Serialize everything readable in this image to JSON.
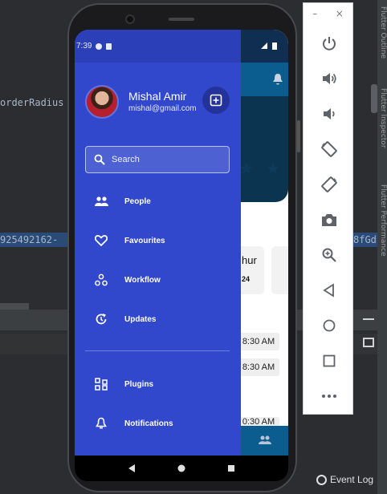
{
  "ide": {
    "code_left": "orderRadius",
    "highlight_left": "925492162-",
    "highlight_right": "8fGd",
    "side_labels": [
      "Flutter Outline",
      "Flutter Inspector",
      "Flutter Performance"
    ],
    "event_log": "Event Log"
  },
  "phone": {
    "status_time": "7:39",
    "drawer": {
      "user": {
        "name": "Mishal Amir",
        "email": "mishal@gmail.com"
      },
      "search": {
        "placeholder": "Search"
      },
      "items": [
        {
          "label": "People",
          "icon": "people-icon"
        },
        {
          "label": "Favourites",
          "icon": "heart-icon"
        },
        {
          "label": "Workflow",
          "icon": "workflow-icon"
        },
        {
          "label": "Updates",
          "icon": "updates-icon"
        }
      ],
      "secondary_items": [
        {
          "label": "Plugins",
          "icon": "plugins-icon"
        },
        {
          "label": "Notifications",
          "icon": "bell-icon"
        }
      ]
    },
    "background_app": {
      "card_text_1": "hur",
      "card_text_2": "24",
      "times": [
        "8:30 AM",
        "8:30 AM",
        "0:30 AM"
      ]
    }
  },
  "emulator": {
    "minimize_label": "–",
    "close_label": "×",
    "buttons": [
      "power-icon",
      "volume-up-icon",
      "volume-down-icon",
      "rotate-left-icon",
      "rotate-right-icon",
      "camera-icon",
      "zoom-icon",
      "back-icon",
      "home-icon",
      "overview-icon",
      "more-icon"
    ]
  }
}
